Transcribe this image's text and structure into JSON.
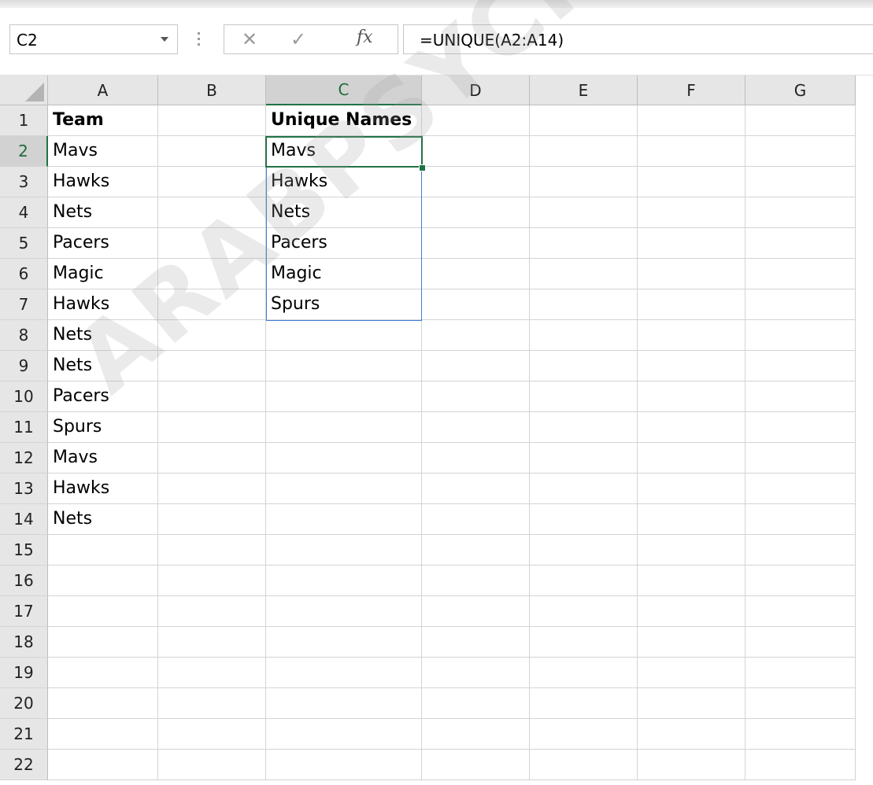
{
  "formula_bar": {
    "name_box": "C2",
    "cancel_icon": "cancel-icon",
    "enter_icon": "enter-icon",
    "fx_label": "fx",
    "formula": "=UNIQUE(A2:A14)"
  },
  "sheet": {
    "columns": [
      "A",
      "B",
      "C",
      "D",
      "E",
      "F",
      "G"
    ],
    "rows": [
      "1",
      "2",
      "3",
      "4",
      "5",
      "6",
      "7",
      "8",
      "9",
      "10",
      "11",
      "12",
      "13",
      "14",
      "15",
      "16",
      "17",
      "18",
      "19",
      "20",
      "21",
      "22"
    ],
    "selected_column": "C",
    "selected_row": "2",
    "column_a": [
      "Team",
      "Mavs",
      "Hawks",
      "Nets",
      "Pacers",
      "Magic",
      "Hawks",
      "Nets",
      "Nets",
      "Pacers",
      "Spurs",
      "Mavs",
      "Hawks",
      "Nets"
    ],
    "column_c": [
      "Unique Names",
      "Mavs",
      "Hawks",
      "Nets",
      "Pacers",
      "Magic",
      "Spurs"
    ],
    "bold_rows": [
      "1"
    ]
  },
  "colors": {
    "selection": "#217346",
    "spill_border": "#3f7fd6",
    "header_bg": "#e6e6e6",
    "gridline": "#d4d4d4"
  },
  "watermark": "ARABPSYCHOLOGY.COM"
}
